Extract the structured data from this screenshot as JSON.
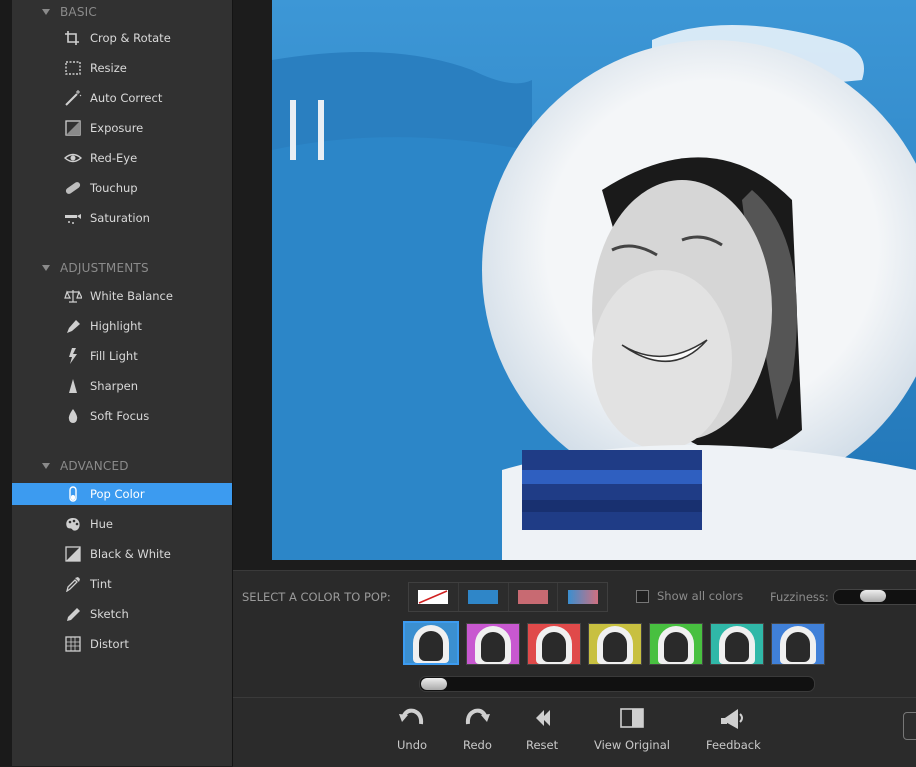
{
  "sidebar": {
    "sections": [
      {
        "title": "BASIC",
        "items": [
          {
            "label": "Crop & Rotate",
            "icon": "crop-icon"
          },
          {
            "label": "Resize",
            "icon": "resize-icon"
          },
          {
            "label": "Auto Correct",
            "icon": "magic-wand-icon"
          },
          {
            "label": "Exposure",
            "icon": "exposure-icon"
          },
          {
            "label": "Red-Eye",
            "icon": "eye-icon"
          },
          {
            "label": "Touchup",
            "icon": "bandage-icon"
          },
          {
            "label": "Saturation",
            "icon": "saturation-icon"
          }
        ]
      },
      {
        "title": "ADJUSTMENTS",
        "items": [
          {
            "label": "White Balance",
            "icon": "scale-icon"
          },
          {
            "label": "Highlight",
            "icon": "highlight-icon"
          },
          {
            "label": "Fill Light",
            "icon": "lightning-icon"
          },
          {
            "label": "Sharpen",
            "icon": "sharpen-icon"
          },
          {
            "label": "Soft Focus",
            "icon": "drop-icon"
          }
        ]
      },
      {
        "title": "ADVANCED",
        "items": [
          {
            "label": "Pop Color",
            "icon": "test-tube-icon",
            "active": true
          },
          {
            "label": "Hue",
            "icon": "palette-icon"
          },
          {
            "label": "Black & White",
            "icon": "black-white-icon"
          },
          {
            "label": "Tint",
            "icon": "eyedropper-icon"
          },
          {
            "label": "Sketch",
            "icon": "pencil-icon"
          },
          {
            "label": "Distort",
            "icon": "distort-icon"
          }
        ]
      }
    ]
  },
  "pop": {
    "label": "SELECT A COLOR TO POP:",
    "swatches": [
      {
        "name": "none",
        "color": "#ffffff"
      },
      {
        "name": "blue",
        "color": "#2f86c8"
      },
      {
        "name": "pink",
        "color": "#c86a72"
      },
      {
        "name": "gradient",
        "color": "#8a7aa8"
      }
    ],
    "show_all_label": "Show all colors",
    "show_all_checked": false,
    "fuzziness_label": "Fuzziness:",
    "thumb_colors": [
      "#3b8fd0",
      "#c858d0",
      "#e04a4a",
      "#c8c040",
      "#48c040",
      "#30b8a8",
      "#4080d8"
    ],
    "selected_thumb": 0
  },
  "toolbar": {
    "undo": "Undo",
    "redo": "Redo",
    "reset": "Reset",
    "view_original": "View Original",
    "feedback": "Feedback"
  },
  "colors": {
    "accent": "#3c9bf0",
    "sidebar_bg": "#313131",
    "sky": "#2d88c6"
  }
}
